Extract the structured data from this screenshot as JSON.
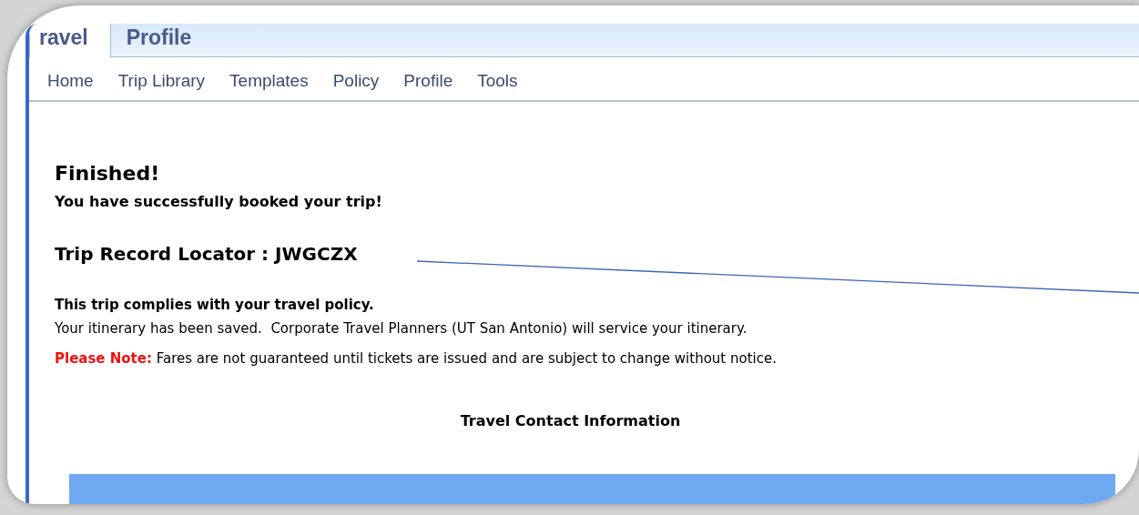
{
  "app_tabs": [
    {
      "label": "ravel",
      "selected": true
    },
    {
      "label": "Profile",
      "selected": false
    }
  ],
  "nav": [
    "Home",
    "Trip Library",
    "Templates",
    "Policy",
    "Profile",
    "Tools"
  ],
  "confirmation": {
    "heading": "Finished!",
    "message": "You have successfully booked your trip!",
    "locator": "Trip Record Locator : JWGCZX",
    "policy": "This trip complies with your travel policy.",
    "saved": "Your itinerary has been saved.  Corporate Travel Planners (UT San Antonio) will service your itinerary.",
    "note_label": "Please Note:",
    "note": "Fares are not guaranteed until tickets are issued and are subject to change without notice."
  },
  "contact_heading": "Travel Contact Information"
}
